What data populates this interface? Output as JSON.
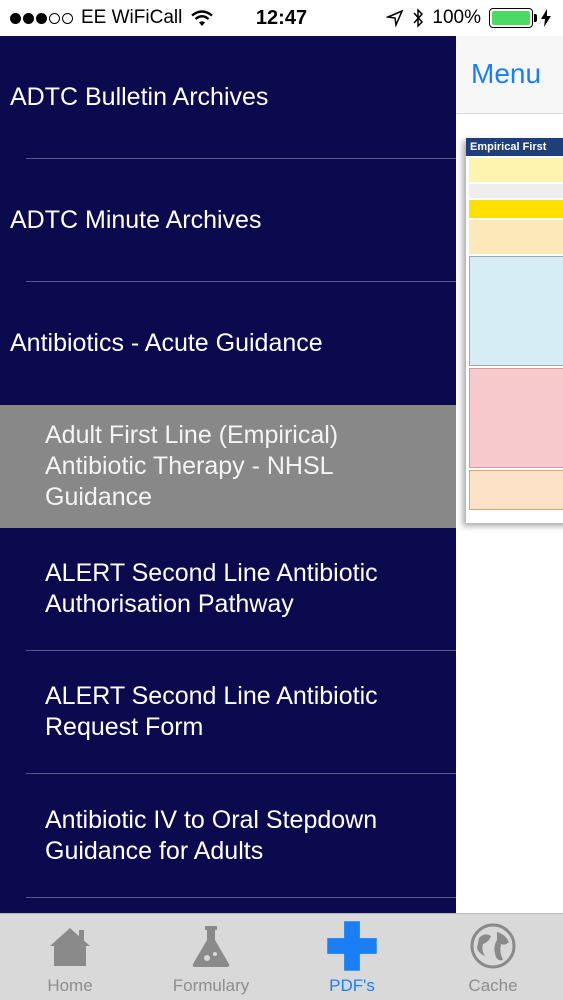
{
  "status_bar": {
    "carrier": "EE WiFiCall",
    "time": "12:47",
    "battery": "100%",
    "battery_level": 1.0,
    "icons": [
      "wifi-icon",
      "location-icon",
      "bluetooth-icon",
      "charging-icon"
    ]
  },
  "menu": {
    "items": [
      {
        "label": "ADTC Bulletin Archives",
        "level": 0
      },
      {
        "label": "ADTC Minute Archives",
        "level": 0
      },
      {
        "label": "Antibiotics - Acute Guidance",
        "level": 0
      },
      {
        "label": "Adult First Line (Empirical) Antibiotic Therapy - NHSL Guidance",
        "level": 1,
        "selected": true
      },
      {
        "label": "ALERT Second Line Antibiotic Authorisation Pathway",
        "level": 1
      },
      {
        "label": "ALERT Second Line Antibiotic Request Form",
        "level": 1
      },
      {
        "label": "Antibiotic IV to Oral Stepdown Guidance for Adults",
        "level": 1
      }
    ]
  },
  "content": {
    "menu_button": "Menu",
    "pdf_title": "Empirical First"
  },
  "tabs": [
    {
      "label": "Home",
      "icon": "home-icon"
    },
    {
      "label": "Formulary",
      "icon": "flask-icon"
    },
    {
      "label": "PDF's",
      "icon": "plus-cross-icon",
      "active": true
    },
    {
      "label": "Cache",
      "icon": "globe-icon"
    }
  ],
  "colors": {
    "menu_background": "#0c0a4f",
    "selected_background": "#888888",
    "accent": "#1a7ff5",
    "battery": "#4cd964"
  }
}
